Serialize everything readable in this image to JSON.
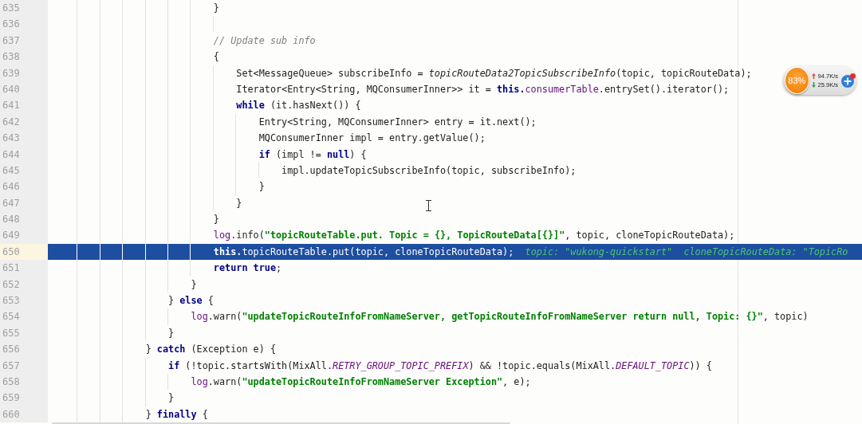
{
  "editor": {
    "lines": [
      {
        "number": "635",
        "selected": false,
        "tokens": [
          {
            "text": "                            }",
            "kind": "plain"
          }
        ]
      },
      {
        "number": "636",
        "selected": false
      },
      {
        "number": "637",
        "selected": false,
        "tokens": [
          {
            "text": "                            // Update sub info",
            "kind": "comment"
          }
        ]
      },
      {
        "number": "638",
        "selected": false,
        "tokens": [
          {
            "text": "                            {",
            "kind": "plain"
          }
        ]
      },
      {
        "number": "639",
        "selected": false,
        "tokens": [
          {
            "text": "                                Set<MessageQueue> subscribeInfo = ",
            "kind": "plain"
          },
          {
            "text": "topicRouteData2TopicSubscribeInfo",
            "kind": "italic"
          },
          {
            "text": "(topic, topicRouteData);",
            "kind": "plain"
          }
        ]
      },
      {
        "number": "640",
        "selected": false,
        "tokens": [
          {
            "text": "                                Iterator<Entry<String, MQConsumerInner>> it = ",
            "kind": "plain"
          },
          {
            "text": "this.",
            "kind": "keyword"
          },
          {
            "text": "consumerTable",
            "kind": "field"
          },
          {
            "text": ".entrySet().iterator();",
            "kind": "plain"
          }
        ]
      },
      {
        "number": "641",
        "selected": false,
        "tokens": [
          {
            "text": "                                while",
            "kind": "keyword"
          },
          {
            "text": " (it.hasNext()) {",
            "kind": "plain"
          }
        ]
      },
      {
        "number": "642",
        "selected": false,
        "tokens": [
          {
            "text": "                                    Entry<String, MQConsumerInner> entry = it.next();",
            "kind": "plain"
          }
        ]
      },
      {
        "number": "643",
        "selected": false,
        "tokens": [
          {
            "text": "                                    MQConsumerInner impl = entry.getValue();",
            "kind": "plain"
          }
        ]
      },
      {
        "number": "644",
        "selected": false,
        "tokens": [
          {
            "text": "                                    if",
            "kind": "keyword"
          },
          {
            "text": " (impl != ",
            "kind": "plain"
          },
          {
            "text": "null",
            "kind": "keyword"
          },
          {
            "text": ") {",
            "kind": "plain"
          }
        ]
      },
      {
        "number": "645",
        "selected": false,
        "tokens": [
          {
            "text": "                                        impl.updateTopicSubscribeInfo(topic, subscribeInfo);",
            "kind": "plain"
          }
        ]
      },
      {
        "number": "646",
        "selected": false,
        "tokens": [
          {
            "text": "                                    }",
            "kind": "plain"
          }
        ]
      },
      {
        "number": "647",
        "selected": false,
        "tokens": [
          {
            "text": "                                }",
            "kind": "plain"
          }
        ]
      },
      {
        "number": "648",
        "selected": false,
        "tokens": [
          {
            "text": "                            }",
            "kind": "plain"
          }
        ]
      },
      {
        "number": "649",
        "selected": false,
        "tokens": [
          {
            "text": "                            log",
            "kind": "field"
          },
          {
            "text": ".info(",
            "kind": "plain"
          },
          {
            "text": "\"topicRouteTable.put. Topic = {}, TopicRouteData[{}]\"",
            "kind": "string"
          },
          {
            "text": ", topic, cloneTopicRouteData);",
            "kind": "plain"
          }
        ]
      },
      {
        "number": "650",
        "selected": true,
        "tokens": [
          {
            "text": "                            this.",
            "kind": "keyword"
          },
          {
            "text": "topicRouteTable",
            "kind": "field"
          },
          {
            "text": ".put(topic, cloneTopicRouteData);",
            "kind": "plain"
          },
          {
            "text": "  topic: \"wukong-quickstart\"  cloneTopicRouteData: \"TopicRo",
            "kind": "hint"
          }
        ]
      },
      {
        "number": "651",
        "selected": false,
        "tokens": [
          {
            "text": "                            return true",
            "kind": "keyword"
          },
          {
            "text": ";",
            "kind": "plain"
          }
        ]
      },
      {
        "number": "652",
        "selected": false,
        "tokens": [
          {
            "text": "                        }",
            "kind": "plain"
          }
        ]
      },
      {
        "number": "653",
        "selected": false,
        "tokens": [
          {
            "text": "                    } ",
            "kind": "plain"
          },
          {
            "text": "else",
            "kind": "keyword"
          },
          {
            "text": " {",
            "kind": "plain"
          }
        ]
      },
      {
        "number": "654",
        "selected": false,
        "tokens": [
          {
            "text": "                        log",
            "kind": "field"
          },
          {
            "text": ".warn(",
            "kind": "plain"
          },
          {
            "text": "\"updateTopicRouteInfoFromNameServer, getTopicRouteInfoFromNameServer return null, Topic: {}\"",
            "kind": "string"
          },
          {
            "text": ", topic)",
            "kind": "plain"
          }
        ]
      },
      {
        "number": "655",
        "selected": false,
        "tokens": [
          {
            "text": "                    }",
            "kind": "plain"
          }
        ]
      },
      {
        "number": "656",
        "selected": false,
        "tokens": [
          {
            "text": "                } ",
            "kind": "plain"
          },
          {
            "text": "catch",
            "kind": "keyword"
          },
          {
            "text": " (Exception e) {",
            "kind": "plain"
          }
        ]
      },
      {
        "number": "657",
        "selected": false,
        "tokens": [
          {
            "text": "                    if",
            "kind": "keyword"
          },
          {
            "text": " (!topic.startsWith(MixAll.",
            "kind": "plain"
          },
          {
            "text": "RETRY_GROUP_TOPIC_PREFIX",
            "kind": "constant"
          },
          {
            "text": ") && !topic.equals(MixAll.",
            "kind": "plain"
          },
          {
            "text": "DEFAULT_TOPIC",
            "kind": "constant"
          },
          {
            "text": ")) {",
            "kind": "plain"
          }
        ]
      },
      {
        "number": "658",
        "selected": false,
        "tokens": [
          {
            "text": "                        log",
            "kind": "field"
          },
          {
            "text": ".warn(",
            "kind": "plain"
          },
          {
            "text": "\"updateTopicRouteInfoFromNameServer Exception\"",
            "kind": "string"
          },
          {
            "text": ", e);",
            "kind": "plain"
          }
        ]
      },
      {
        "number": "659",
        "selected": false,
        "tokens": [
          {
            "text": "                    }",
            "kind": "plain"
          }
        ]
      },
      {
        "number": "660",
        "selected": false,
        "tokens": [
          {
            "text": "                } ",
            "kind": "plain"
          },
          {
            "text": "finally",
            "kind": "keyword"
          },
          {
            "text": " {",
            "kind": "plain"
          }
        ]
      }
    ]
  },
  "network_widget": {
    "cpu": "83%",
    "upload": "94.7K/s",
    "download": "25.9K/s"
  }
}
